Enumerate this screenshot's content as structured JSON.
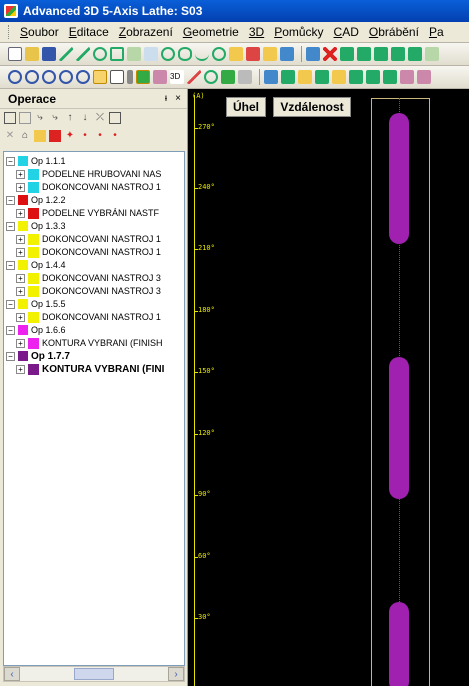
{
  "window": {
    "title": "Advanced 3D 5-Axis Lathe: S03"
  },
  "menu": [
    {
      "ul": "S",
      "rest": "oubor"
    },
    {
      "ul": "E",
      "rest": "ditace"
    },
    {
      "ul": "Z",
      "rest": "obrazení"
    },
    {
      "ul": "G",
      "rest": "eometrie"
    },
    {
      "ul": "3D",
      "rest": ""
    },
    {
      "ul": "P",
      "rest": "omůcky"
    },
    {
      "ul": "C",
      "rest": "AD"
    },
    {
      "ul": "O",
      "rest": "brábění"
    },
    {
      "ul": "P",
      "rest": "a"
    }
  ],
  "panel": {
    "title": "Operace",
    "pin": "ᵻ",
    "close": "×"
  },
  "tree": {
    "ops": [
      {
        "label": "Op 1.1.1",
        "color": "#22d3e6",
        "children": [
          "PODELNE HRUBOVANI  NAS",
          "DOKONCOVANI  NASTROJ 1"
        ]
      },
      {
        "label": "Op 1.2.2",
        "color": "#dd1111",
        "children": [
          "PODELNE VYBRÁNI  NASTF"
        ]
      },
      {
        "label": "Op 1.3.3",
        "color": "#f2f200",
        "children": [
          "DOKONCOVANI  NASTROJ 1",
          "DOKONCOVANI  NASTROJ 1"
        ]
      },
      {
        "label": "Op 1.4.4",
        "color": "#f2f200",
        "children": [
          "DOKONCOVANI  NASTROJ 3",
          "DOKONCOVANI  NASTROJ 3"
        ]
      },
      {
        "label": "Op 1.5.5",
        "color": "#f2f200",
        "children": [
          "DOKONCOVANI  NASTROJ 1"
        ]
      },
      {
        "label": "Op 1.6.6",
        "color": "#ee22ee",
        "children": [
          "KONTURA VYBRANI (FINISH"
        ]
      },
      {
        "label": "Op 1.7.7",
        "color": "#7a1a8a",
        "children": [
          "KONTURA VYBRANI (FINI"
        ]
      }
    ]
  },
  "view": {
    "tag": "(A)",
    "angle_button": "Úhel",
    "distance_button": "Vzdálenost",
    "ruler_labels": [
      "270°",
      "240°",
      "210°",
      "180°",
      "150°",
      "120°",
      "90°",
      "60°",
      "30°"
    ]
  },
  "colors": {
    "accent": "#0a5fd8",
    "ruler": "#e6e600",
    "pill": "#a020b0"
  }
}
